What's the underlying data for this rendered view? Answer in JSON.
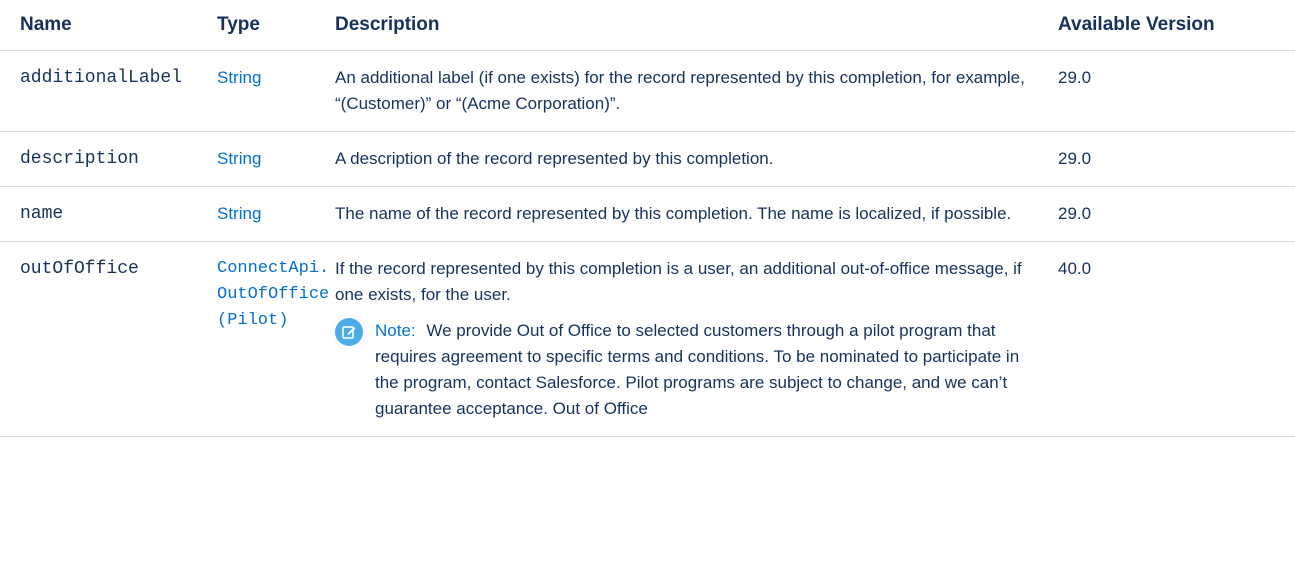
{
  "headers": {
    "name": "Name",
    "type": "Type",
    "description": "Description",
    "version": "Available Version"
  },
  "rows": [
    {
      "name": "additionalLabel",
      "type": "String",
      "description": "An additional label (if one exists) for the record represented by this completion, for example, “(Customer)” or “(Acme Corporation)”.",
      "version": "29.0"
    },
    {
      "name": "description",
      "type": "String",
      "description": "A description of the record represented by this completion.",
      "version": "29.0"
    },
    {
      "name": "name",
      "type": "String",
      "description": "The name of the record represented by this completion. The name is localized, if possible.",
      "version": "29.0"
    },
    {
      "name": "outOfOffice",
      "type_line1": "ConnectApi.",
      "type_line2": "OutOfOffice",
      "type_line3": "(Pilot)",
      "description": "If the record represented by this completion is a user, an additional out-of-office message, if one exists, for the user.",
      "version": "40.0",
      "note_label": "Note:",
      "note_text": "We provide Out of Office to selected customers through a pilot program that requires agreement to specific terms and conditions. To be nominated to participate in the program, contact Salesforce. Pilot programs are subject to change, and we can’t guarantee acceptance. Out of Office"
    }
  ],
  "icons": {
    "note": "edit-note-icon"
  },
  "colors": {
    "link": "#0070d2",
    "text": "#16325c",
    "note_icon_bg": "#4bade8"
  }
}
